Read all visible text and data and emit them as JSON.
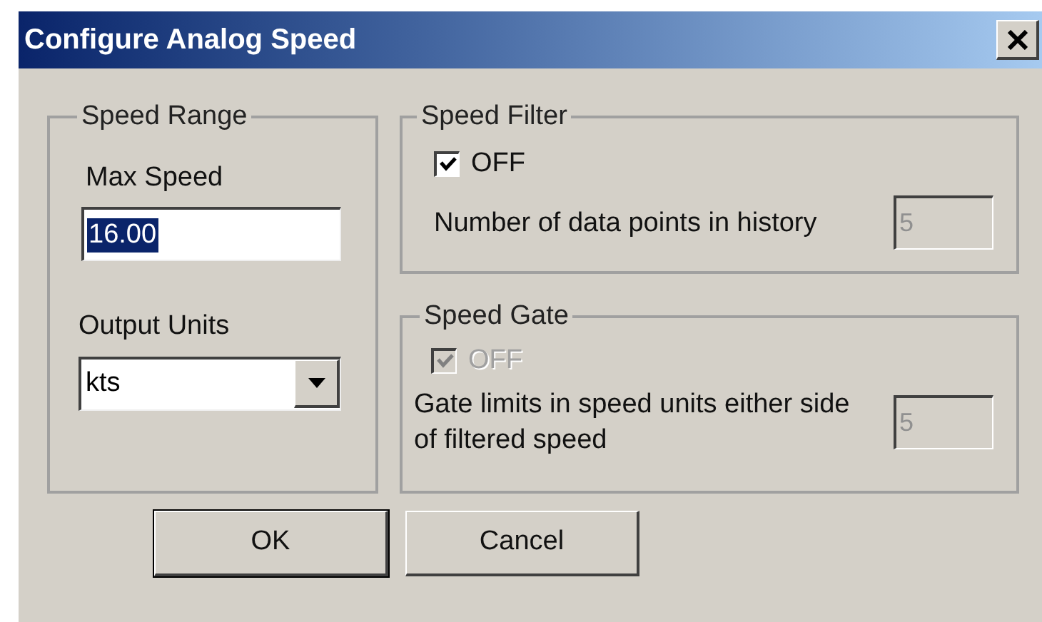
{
  "window": {
    "title": "Configure Analog Speed"
  },
  "speed_range": {
    "title": "Speed Range",
    "max_speed": {
      "label": "Max Speed",
      "value": "16.00",
      "text_selected": true
    },
    "output_units": {
      "label": "Output Units",
      "value": "kts"
    }
  },
  "speed_filter": {
    "title": "Speed Filter",
    "checkbox": {
      "label": "OFF",
      "checked": true,
      "disabled": false
    },
    "field": {
      "label": "Number of data points in history",
      "value": "5",
      "disabled": true
    }
  },
  "speed_gate": {
    "title": "Speed Gate",
    "checkbox": {
      "label": "OFF",
      "checked": true,
      "disabled": true
    },
    "field": {
      "label": "Gate limits in speed units either side of filtered speed",
      "value": "5",
      "disabled": true
    }
  },
  "buttons": [
    {
      "label": "OK",
      "default": true
    },
    {
      "label": "Cancel",
      "default": false
    }
  ]
}
